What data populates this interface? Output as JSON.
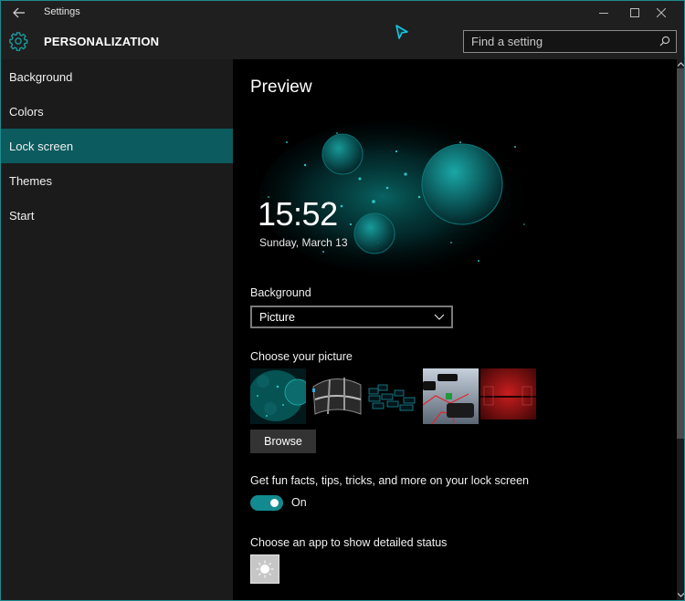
{
  "window": {
    "app_title": "Settings",
    "controls": {
      "minimize": "minimize",
      "maximize": "maximize",
      "close": "close"
    }
  },
  "header": {
    "section_title": "PERSONALIZATION",
    "search_placeholder": "Find a setting"
  },
  "sidebar": {
    "items": [
      {
        "label": "Background",
        "active": false
      },
      {
        "label": "Colors",
        "active": false
      },
      {
        "label": "Lock screen",
        "active": true
      },
      {
        "label": "Themes",
        "active": false
      },
      {
        "label": "Start",
        "active": false
      }
    ]
  },
  "main": {
    "preview_heading": "Preview",
    "preview": {
      "time": "15:52",
      "date": "Sunday, March 13"
    },
    "background_label": "Background",
    "background_value": "Picture",
    "choose_picture_label": "Choose your picture",
    "pictures": [
      {
        "name": "cyan-planets"
      },
      {
        "name": "black-windows-flag"
      },
      {
        "name": "cyan-blocks"
      },
      {
        "name": "windows-10-blocks"
      },
      {
        "name": "red-abstract"
      }
    ],
    "browse_label": "Browse",
    "fun_facts_label": "Get fun facts, tips, tricks, and more on your lock screen",
    "fun_facts_state": "On",
    "detailed_status_label": "Choose an app to show detailed status",
    "detailed_status_app": "weather"
  },
  "colors": {
    "accent": "#0c5b5e",
    "toggle_on": "#138a8f",
    "window_border": "#1e8a8f",
    "sidebar_bg": "#1b1b1b",
    "content_bg": "#000000"
  }
}
